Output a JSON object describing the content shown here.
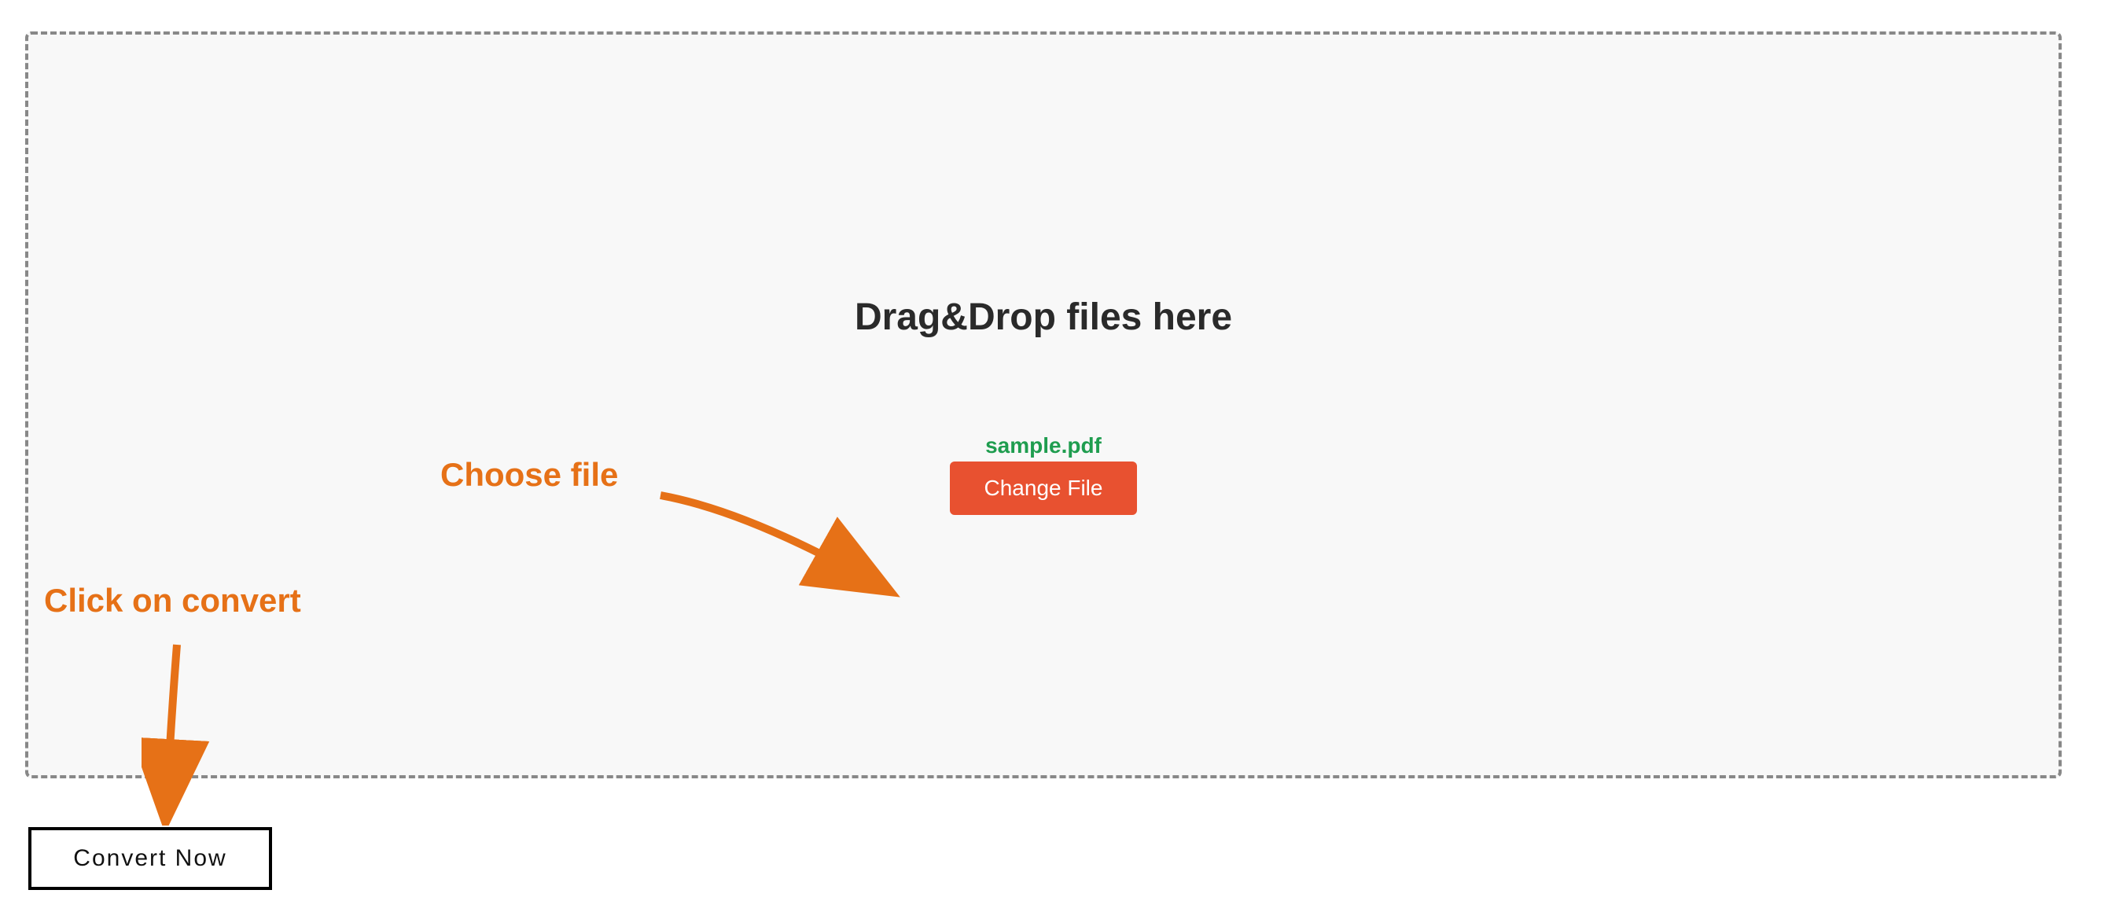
{
  "dropzone": {
    "heading": "Drag&Drop files here",
    "file_name": "sample.pdf",
    "change_file_label": "Change File"
  },
  "convert_button": {
    "label": "Convert Now"
  },
  "annotations": {
    "choose_file": "Choose file",
    "click_convert": "Click on convert"
  }
}
